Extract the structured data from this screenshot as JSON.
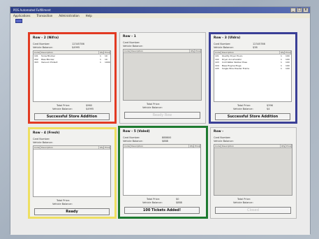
{
  "window": {
    "title": "POS Automated Fulfillment",
    "menu": [
      "Applications",
      "Transaction",
      "Administration",
      "Help"
    ],
    "controls": [
      "_",
      "□",
      "x"
    ]
  },
  "colors": {
    "frame_red": "#e23a22",
    "frame_blue": "#3a3f96",
    "frame_yellow": "#eedf62",
    "frame_green": "#1e7a30",
    "title_bar": "#2d3f86"
  },
  "field_labels": {
    "card_number": "Card Number:",
    "vehicle_balance": "Vehicle Balance:",
    "total_price": "Total Price:",
    "vehicle_balance_bottom": "Vehicle Balance:"
  },
  "columns": [
    "Code",
    "Description",
    "Qty",
    "Price"
  ],
  "lanes": [
    {
      "title": "Row - 2 (Nifra)",
      "card_number": "12345786",
      "vehicle_balance": "$4995",
      "items": [
        {
          "code": "101",
          "desc": "Snow Blocker",
          "qty": "1",
          "price": "10"
        },
        {
          "code": "202",
          "desc": "Pass Blocker",
          "qty": "1",
          "price": "10"
        },
        {
          "code": "303",
          "desc": "Vacuum Protect",
          "qty": "1",
          "price": "1000"
        }
      ],
      "total_price": "$960",
      "balance_after": "$4995",
      "status": "Successful Store Addition",
      "status_disabled": false
    },
    {
      "title": "Row - 1",
      "card_number": "",
      "vehicle_balance": "",
      "items": [],
      "total_price": "",
      "balance_after": "",
      "status": "Ready Row",
      "status_disabled": true
    },
    {
      "title": "Row - 3 (Uldra)",
      "card_number": "12345786",
      "vehicle_balance": "$38",
      "items": [
        {
          "code": "101",
          "desc": "Quality Dryer Pours",
          "qty": "1",
          "price": "100"
        },
        {
          "code": "102",
          "desc": "Dryer Accumulator",
          "qty": "1",
          "price": "100"
        },
        {
          "code": "103",
          "desc": "Cold Water Rubber Pose",
          "qty": "1",
          "price": "100"
        },
        {
          "code": "104",
          "desc": "Base Engine Plugs",
          "qty": "1",
          "price": "100"
        },
        {
          "code": "105",
          "desc": "Single Wire Powder Frame",
          "qty": "1",
          "price": "100"
        }
      ],
      "total_price": "$396",
      "balance_after": "$4",
      "status": "Successful Store Addition",
      "status_disabled": false
    },
    {
      "title": "Row - 4 (Fresh)",
      "card_number": "",
      "vehicle_balance": "",
      "items": [],
      "total_price": "",
      "balance_after": "",
      "status": "Ready",
      "status_disabled": false
    },
    {
      "title": "Row - 5 (Valed)",
      "card_number": "888600",
      "vehicle_balance": "$888",
      "items": [],
      "total_price": "$0",
      "balance_after": "$888",
      "status": "100 Tickets Added!",
      "status_disabled": false
    },
    {
      "title": "Row -",
      "card_number": "",
      "vehicle_balance": "",
      "items": [],
      "total_price": "",
      "balance_after": "",
      "status": "Closed",
      "status_disabled": true
    }
  ]
}
